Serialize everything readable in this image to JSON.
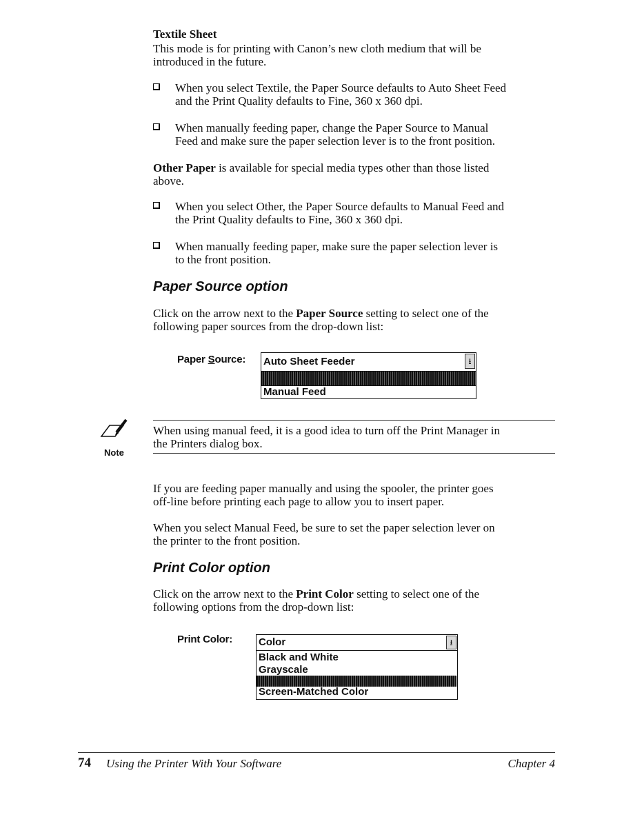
{
  "textile": {
    "heading": "Textile Sheet",
    "intro": [
      "This mode is for printing with Canon’s new cloth medium that will be",
      "introduced in the future."
    ],
    "bullets": [
      [
        "When you select Textile, the Paper Source defaults to Auto Sheet Feed",
        "and the Print Quality defaults to Fine, 360 x 360 dpi."
      ],
      [
        "When manually feeding paper, change the Paper Source to Manual",
        "Feed and make sure the paper selection lever is to the front position."
      ]
    ]
  },
  "other": {
    "bold_lead": "Other Paper",
    "intro_rest": " is available for special media types other than those listed",
    "intro_line2": "above.",
    "bullets": [
      [
        "When you select Other, the Paper Source defaults to Manual Feed and",
        "the Print Quality defaults to Fine, 360 x 360 dpi."
      ],
      [
        "When manually feeding paper, make sure the paper selection lever is",
        "to the front position."
      ]
    ]
  },
  "paper_source": {
    "heading": "Paper Source option",
    "instr_pre": "Click on the arrow next to the ",
    "instr_bold": "Paper Source",
    "instr_post": " setting to select one of the",
    "instr_line2": "following paper sources from the drop-down list:",
    "label_pre": "Paper ",
    "label_underlined": "S",
    "label_post": "ource:",
    "selected": "Auto Sheet Feeder",
    "options": [
      "Manual Feed"
    ],
    "arrow_icon": "down-arrow-icon"
  },
  "note": {
    "icon": "pencil-note-icon",
    "label": "Note",
    "lines": [
      "When using manual feed, it is a good idea to turn off the Print Manager in",
      "the Printers dialog box."
    ]
  },
  "spooler": {
    "p1": [
      "If you are feeding paper manually and using the spooler, the printer goes",
      "off-line before printing each page to allow you to insert paper."
    ],
    "p2": [
      "When you select Manual Feed, be sure to set the paper selection lever on",
      "the printer to the front position."
    ]
  },
  "print_color": {
    "heading": "Print Color option",
    "instr_pre": "Click on the arrow next to the ",
    "instr_bold": "Print Color",
    "instr_post": " setting to select one of the",
    "instr_line2": "following options from the drop-down list:",
    "label": "Print Color:",
    "selected": "Color",
    "options": [
      "Black and White",
      "Grayscale",
      "Screen-Matched Color"
    ],
    "arrow_icon": "down-arrow-icon"
  },
  "footer": {
    "page_number": "74",
    "title": "Using the Printer With Your Software",
    "chapter": "Chapter 4"
  }
}
